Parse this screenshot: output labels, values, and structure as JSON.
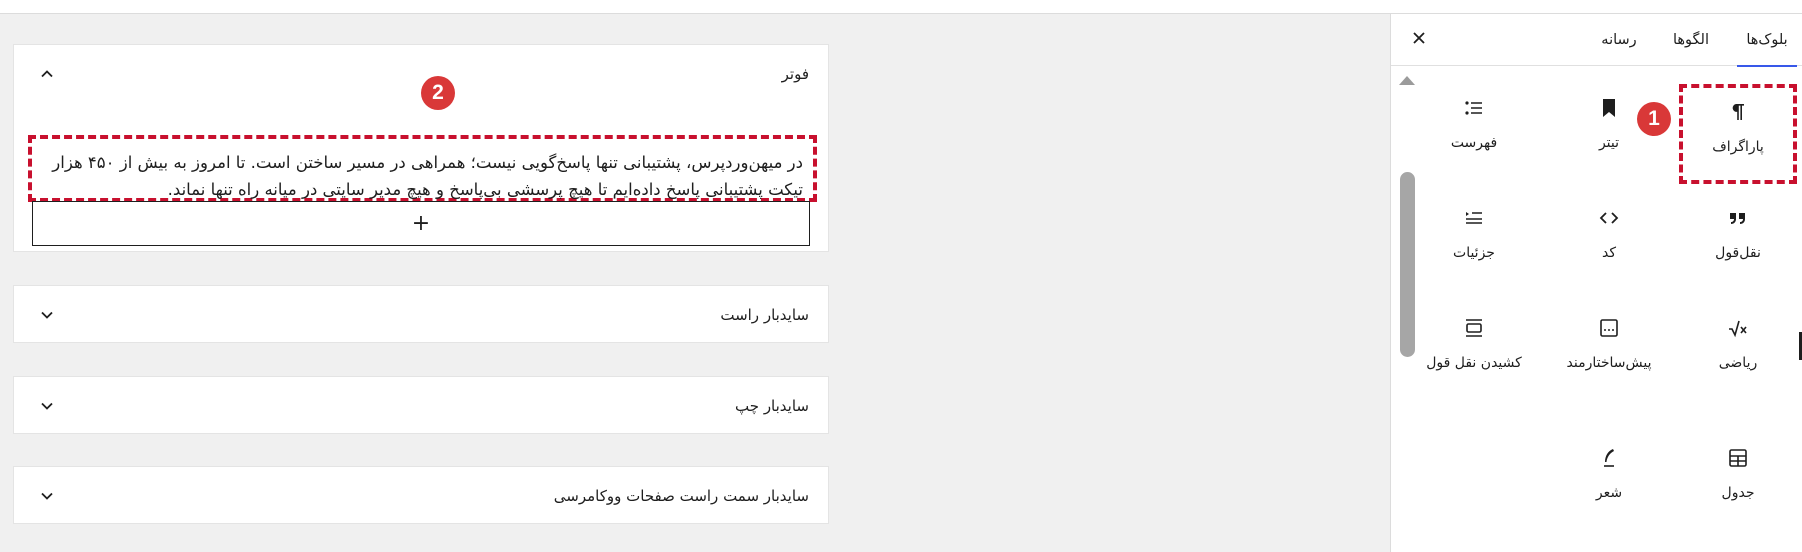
{
  "sidebar": {
    "tabs": [
      {
        "label": "بلوک‌ها",
        "active": true
      },
      {
        "label": "الگوها",
        "active": false
      },
      {
        "label": "رسانه",
        "active": false
      }
    ],
    "close_icon": "close-icon",
    "blocks": [
      {
        "label": "پاراگراف",
        "icon": "paragraph-icon"
      },
      {
        "label": "تیتر",
        "icon": "heading-bookmark-icon"
      },
      {
        "label": "فهرست",
        "icon": "list-icon"
      },
      {
        "label": "نقل‌قول",
        "icon": "quote-icon"
      },
      {
        "label": "کد",
        "icon": "code-icon"
      },
      {
        "label": "جزئیات",
        "icon": "details-icon"
      },
      {
        "label": "ریاضی",
        "icon": "math-icon"
      },
      {
        "label": "پیش‌ساختارمند",
        "icon": "preformatted-icon"
      },
      {
        "label": "کشیدن نقل قول",
        "icon": "pullquote-icon"
      },
      {
        "label": "جدول",
        "icon": "table-icon"
      },
      {
        "label": "شعر",
        "icon": "verse-icon"
      }
    ]
  },
  "main": {
    "panels": [
      {
        "title": "فوتر",
        "expanded": true
      },
      {
        "title": "سایدبار راست",
        "expanded": false
      },
      {
        "title": "سایدبار چپ",
        "expanded": false
      },
      {
        "title": "سایدبار سمت راست صفحات ووکامرسی",
        "expanded": false
      }
    ],
    "footer_paragraph": "در میهن‌وردپرس، پشتیبانی تنها پاسخ‌گویی نیست؛ همراهی در مسیر ساختن است. تا امروز به بیش از ۴۵۰ هزار تیکت پشتیبانی پاسخ داده‌ایم تا هیچ پرسشی بی‌پاسخ و هیچ مدیر سایتی در میانه راه تنها نماند.",
    "add_block_symbol": "+"
  },
  "annotations": {
    "badge_1": "1",
    "badge_2": "2"
  },
  "colors": {
    "highlight": "#c8102e",
    "badge": "#d93838",
    "accent": "#3858e9"
  }
}
